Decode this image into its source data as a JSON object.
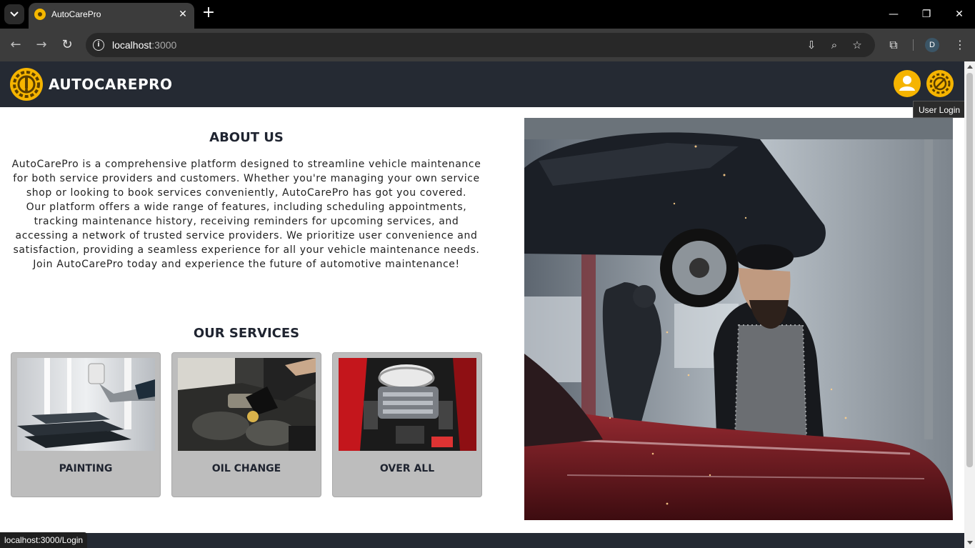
{
  "browser": {
    "tab_title": "AutoCarePro",
    "url_host": "localhost",
    "url_port": ":3000",
    "profile_initial": "D",
    "status_link": "localhost:3000/Login"
  },
  "header": {
    "brand_name": "AUTOCAREPRO",
    "tooltip": "User Login"
  },
  "about": {
    "title": "ABOUT US",
    "paragraphs": [
      "AutoCarePro is a comprehensive platform designed to streamline vehicle maintenance for both service providers and customers. Whether you're managing your own service shop or looking to book services conveniently, AutoCarePro has got you covered.",
      "Our platform offers a wide range of features, including scheduling appointments, tracking maintenance history, receiving reminders for upcoming services, and accessing a network of trusted service providers. We prioritize user convenience and satisfaction, providing a seamless experience for all your vehicle maintenance needs.",
      "Join AutoCarePro today and experience the future of automotive maintenance!"
    ]
  },
  "services": {
    "title": "OUR SERVICES",
    "items": [
      {
        "label": "PAINTING"
      },
      {
        "label": "OIL CHANGE"
      },
      {
        "label": "OVER ALL"
      }
    ]
  },
  "colors": {
    "header_bg": "#252a33",
    "accent": "#f5b400",
    "card_bg": "#bdbdbd"
  }
}
